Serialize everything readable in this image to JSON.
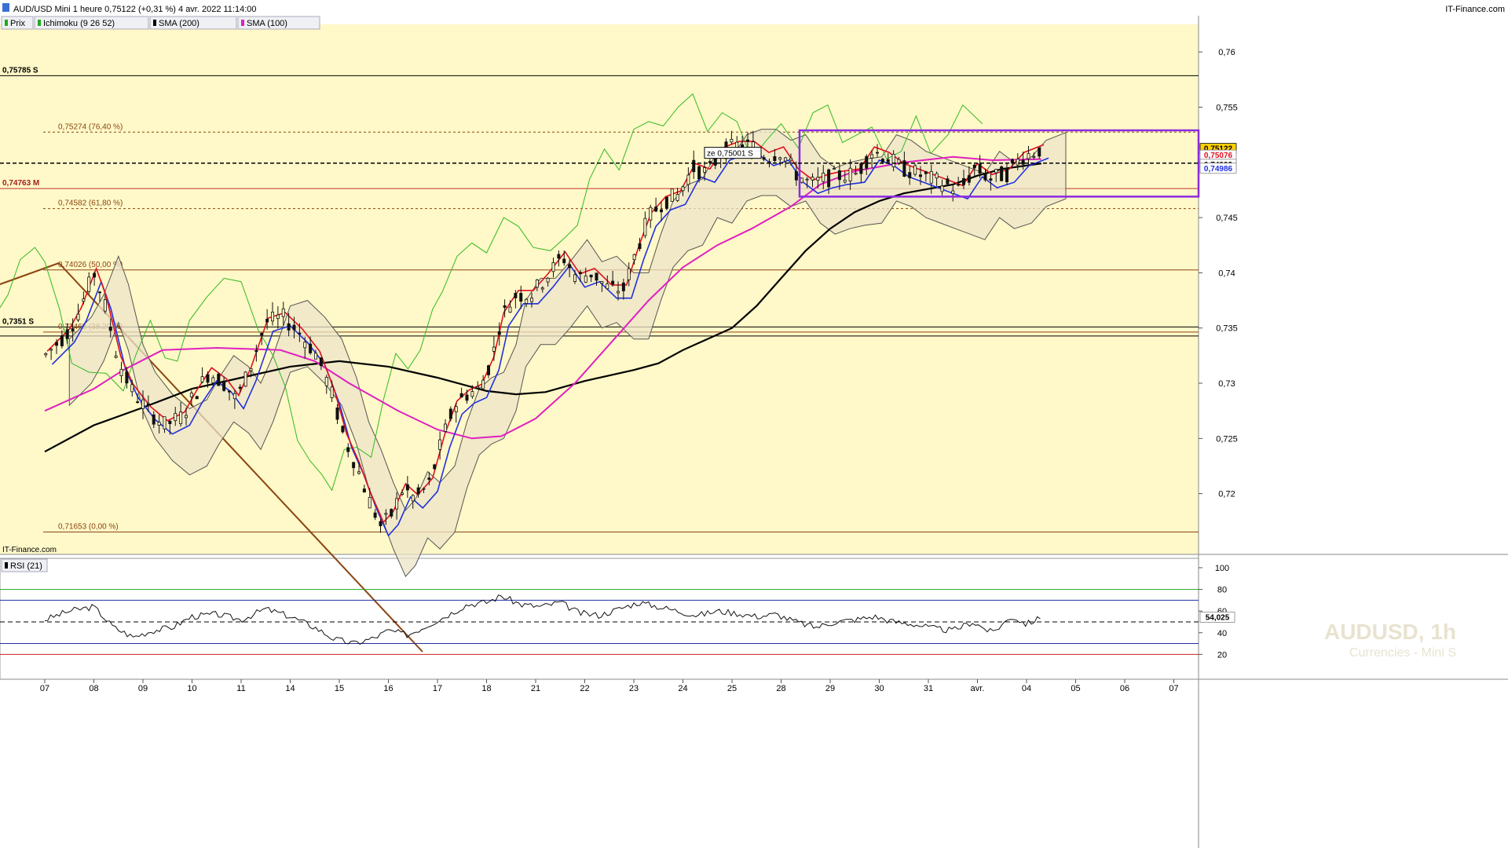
{
  "header": {
    "title": "AUD/USD Mini 1 heure 0,75122 (+0,31 %) 4 avr. 2022 11:14:00",
    "brand": "IT-Finance.com",
    "brand_bottom": "IT-Finance.com",
    "watermark_title": "AUDUSD, 1h",
    "watermark_sub": "Currencies - Mini S"
  },
  "legend": [
    {
      "label": "Prix",
      "color": "#22aa22"
    },
    {
      "label": "Ichimoku (9 26 52)",
      "color": "#22aa22"
    },
    {
      "label": "SMA (200)",
      "color": "#000000"
    },
    {
      "label": "SMA (100)",
      "color": "#e020c0"
    }
  ],
  "rsi": {
    "label": "RSI (21)",
    "value_label": "54,025",
    "ticks": [
      "100",
      "80",
      "60",
      "40",
      "20"
    ]
  },
  "colors": {
    "background": "#fff8c8",
    "price_up": "#222222",
    "tenkan": "#e01020",
    "kijun": "#2030e0",
    "chikou": "#33bb22",
    "sma100": "#e020c0",
    "sma200": "#000000",
    "box": "#8a2be2",
    "trendline": "#8b4513",
    "fib": "#8b4513"
  },
  "chart_data": {
    "type": "candlestick",
    "title": "AUD/USD Mini 1 heure",
    "ylim": [
      0.7145,
      0.7625
    ],
    "y_ticks": [
      "0,76",
      "0,755",
      "0,75",
      "0,745",
      "0,74",
      "0,735",
      "0,73",
      "0,725",
      "0,72"
    ],
    "x_labels": [
      "07",
      "08",
      "09",
      "10",
      "11",
      "14",
      "15",
      "16",
      "17",
      "18",
      "21",
      "22",
      "23",
      "24",
      "25",
      "28",
      "29",
      "30",
      "31",
      "avr.",
      "04",
      "05",
      "06",
      "07"
    ],
    "price_labels": [
      {
        "text": "0,75122",
        "value": 0.75122,
        "bg": "#ffd000",
        "fg": "#000000"
      },
      {
        "text": "0,75076",
        "value": 0.75076,
        "bg": "#ffffff",
        "fg": "#e01020"
      },
      {
        "text": "0,74993",
        "value": 0.74993,
        "bg": "#ffffff",
        "fg": "#000000"
      },
      {
        "text": "0,74986",
        "value": 0.74986,
        "bg": "#ffffff",
        "fg": "#2030e0"
      }
    ],
    "levels": [
      {
        "label": "0,75785 S",
        "value": 0.75785
      },
      {
        "label": "0,74763 M",
        "value": 0.74763
      },
      {
        "label": "0,7351 S",
        "value": 0.7351
      }
    ],
    "fib_levels": [
      {
        "label": "0,75274 (76,40 %)",
        "value": 0.75274
      },
      {
        "label": "0,74582 (61,80 %)",
        "value": 0.74582
      },
      {
        "label": "0,74026 (50,00 %)",
        "value": 0.74026
      },
      {
        "label": "0,73463 (38,20 %)",
        "value": 0.73463
      },
      {
        "label": "0,71653 (0,00 %)",
        "value": 0.71653
      }
    ],
    "annotation": {
      "label": "ze 0,75001 S",
      "value": 0.75001
    },
    "range_box": {
      "high": 0.7529,
      "low": 0.7469
    },
    "path_points": [
      [
        0,
        0.7325
      ],
      [
        0.45,
        0.7345
      ],
      [
        0.7,
        0.7365
      ],
      [
        1.0,
        0.74
      ],
      [
        1.2,
        0.7375
      ],
      [
        1.5,
        0.732
      ],
      [
        1.75,
        0.7295
      ],
      [
        2.1,
        0.7275
      ],
      [
        2.45,
        0.7262
      ],
      [
        2.8,
        0.727
      ],
      [
        3.05,
        0.729
      ],
      [
        3.35,
        0.731
      ],
      [
        3.65,
        0.73
      ],
      [
        3.9,
        0.7285
      ],
      [
        4.15,
        0.731
      ],
      [
        4.5,
        0.7355
      ],
      [
        4.85,
        0.736
      ],
      [
        5.2,
        0.7345
      ],
      [
        5.55,
        0.7325
      ],
      [
        5.85,
        0.729
      ],
      [
        6.1,
        0.725
      ],
      [
        6.35,
        0.7225
      ],
      [
        6.6,
        0.7195
      ],
      [
        6.85,
        0.717
      ],
      [
        7.05,
        0.718
      ],
      [
        7.3,
        0.7205
      ],
      [
        7.55,
        0.7195
      ],
      [
        7.85,
        0.721
      ],
      [
        8.1,
        0.725
      ],
      [
        8.35,
        0.728
      ],
      [
        8.6,
        0.729
      ],
      [
        8.85,
        0.7295
      ],
      [
        9.1,
        0.732
      ],
      [
        9.3,
        0.736
      ],
      [
        9.6,
        0.738
      ],
      [
        9.9,
        0.738
      ],
      [
        10.2,
        0.7395
      ],
      [
        10.55,
        0.7415
      ],
      [
        10.85,
        0.7395
      ],
      [
        11.15,
        0.74
      ],
      [
        11.5,
        0.7385
      ],
      [
        11.8,
        0.7385
      ],
      [
        12.05,
        0.742
      ],
      [
        12.3,
        0.745
      ],
      [
        12.6,
        0.7465
      ],
      [
        12.9,
        0.747
      ],
      [
        13.2,
        0.7495
      ],
      [
        13.5,
        0.749
      ],
      [
        13.8,
        0.751
      ],
      [
        14.1,
        0.7515
      ],
      [
        14.4,
        0.7515
      ],
      [
        14.7,
        0.7505
      ],
      [
        15.0,
        0.751
      ],
      [
        15.3,
        0.749
      ],
      [
        15.6,
        0.748
      ],
      [
        15.9,
        0.7485
      ],
      [
        16.2,
        0.7488
      ],
      [
        16.55,
        0.749
      ],
      [
        16.85,
        0.751
      ],
      [
        17.15,
        0.7505
      ],
      [
        17.45,
        0.7495
      ],
      [
        17.75,
        0.749
      ],
      [
        18.05,
        0.7485
      ],
      [
        18.35,
        0.748
      ],
      [
        18.65,
        0.7475
      ],
      [
        18.95,
        0.7495
      ],
      [
        19.25,
        0.7485
      ],
      [
        19.6,
        0.749
      ],
      [
        19.9,
        0.7505
      ],
      [
        20.3,
        0.7512
      ]
    ],
    "sma200_points": [
      [
        0,
        0.7238
      ],
      [
        1.0,
        0.7262
      ],
      [
        2.0,
        0.7278
      ],
      [
        3.0,
        0.7295
      ],
      [
        4.0,
        0.7305
      ],
      [
        5.0,
        0.7315
      ],
      [
        6.0,
        0.732
      ],
      [
        7.0,
        0.7315
      ],
      [
        8.0,
        0.7305
      ],
      [
        9.0,
        0.7293
      ],
      [
        9.6,
        0.729
      ],
      [
        10.2,
        0.7292
      ],
      [
        11.0,
        0.7302
      ],
      [
        12.0,
        0.7312
      ],
      [
        12.5,
        0.7318
      ],
      [
        13.0,
        0.733
      ],
      [
        14.0,
        0.735
      ],
      [
        14.5,
        0.737
      ],
      [
        15.0,
        0.7395
      ],
      [
        15.5,
        0.742
      ],
      [
        16.0,
        0.744
      ],
      [
        16.5,
        0.7455
      ],
      [
        17.0,
        0.7465
      ],
      [
        17.5,
        0.7472
      ],
      [
        18.5,
        0.748
      ],
      [
        19.0,
        0.7488
      ],
      [
        19.5,
        0.7494
      ],
      [
        20.3,
        0.7499
      ]
    ],
    "sma100_points": [
      [
        0,
        0.7275
      ],
      [
        1.0,
        0.7295
      ],
      [
        1.6,
        0.7312
      ],
      [
        2.4,
        0.733
      ],
      [
        3.5,
        0.7332
      ],
      [
        4.8,
        0.733
      ],
      [
        5.5,
        0.732
      ],
      [
        6.2,
        0.73
      ],
      [
        7.2,
        0.7275
      ],
      [
        8.0,
        0.7258
      ],
      [
        8.7,
        0.725
      ],
      [
        9.3,
        0.7252
      ],
      [
        10.0,
        0.7268
      ],
      [
        10.8,
        0.73
      ],
      [
        11.5,
        0.7335
      ],
      [
        12.3,
        0.7375
      ],
      [
        13.0,
        0.7405
      ],
      [
        13.7,
        0.7425
      ],
      [
        14.4,
        0.744
      ],
      [
        15.2,
        0.746
      ],
      [
        15.8,
        0.748
      ],
      [
        16.5,
        0.7492
      ],
      [
        17.5,
        0.75
      ],
      [
        18.5,
        0.7505
      ],
      [
        19.3,
        0.7502
      ],
      [
        20.3,
        0.7503
      ]
    ],
    "x_labels_index": [
      0,
      1,
      2,
      3,
      4,
      5,
      6,
      7,
      8,
      9,
      10,
      11,
      12,
      13,
      14,
      15,
      16,
      17,
      18,
      19,
      20,
      21,
      22,
      23
    ],
    "rsi_points": [
      [
        0,
        52
      ],
      [
        0.5,
        60
      ],
      [
        1.0,
        64
      ],
      [
        1.4,
        45
      ],
      [
        1.8,
        36
      ],
      [
        2.2,
        42
      ],
      [
        2.6,
        45
      ],
      [
        3.0,
        55
      ],
      [
        3.5,
        57
      ],
      [
        4.0,
        52
      ],
      [
        4.5,
        62
      ],
      [
        5.0,
        55
      ],
      [
        5.5,
        45
      ],
      [
        5.9,
        34
      ],
      [
        6.3,
        30
      ],
      [
        6.7,
        35
      ],
      [
        7.0,
        42
      ],
      [
        7.4,
        38
      ],
      [
        7.8,
        47
      ],
      [
        8.2,
        56
      ],
      [
        8.6,
        66
      ],
      [
        9.0,
        68
      ],
      [
        9.3,
        74
      ],
      [
        9.7,
        66
      ],
      [
        10.1,
        64
      ],
      [
        10.5,
        68
      ],
      [
        10.9,
        58
      ],
      [
        11.3,
        56
      ],
      [
        11.7,
        62
      ],
      [
        12.1,
        68
      ],
      [
        12.5,
        64
      ],
      [
        12.9,
        60
      ],
      [
        13.3,
        56
      ],
      [
        13.7,
        60
      ],
      [
        14.1,
        58
      ],
      [
        14.5,
        55
      ],
      [
        14.9,
        57
      ],
      [
        15.3,
        50
      ],
      [
        15.7,
        45
      ],
      [
        16.1,
        50
      ],
      [
        16.5,
        52
      ],
      [
        16.9,
        55
      ],
      [
        17.3,
        50
      ],
      [
        17.7,
        48
      ],
      [
        18.1,
        44
      ],
      [
        18.5,
        42
      ],
      [
        18.9,
        50
      ],
      [
        19.3,
        40
      ],
      [
        19.7,
        55
      ],
      [
        20.0,
        48
      ],
      [
        20.3,
        54
      ]
    ]
  }
}
